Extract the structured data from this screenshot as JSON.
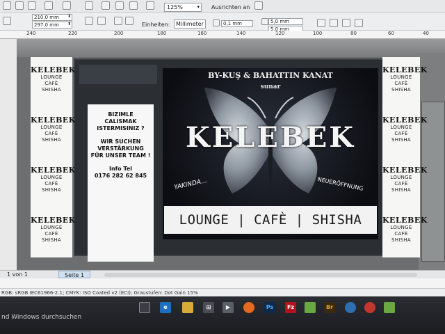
{
  "toolbar": {
    "zoom": "125%",
    "align_label": "Ausrichten an"
  },
  "properties": {
    "width": "210,0 mm",
    "height": "297,0 mm",
    "units_label": "Einheiten:",
    "units_value": "Millimeter",
    "nudge": "0,1 mm",
    "dup_x": "5,0 mm",
    "dup_y": "5,0 mm"
  },
  "ruler": {
    "ticks": [
      "240",
      "220",
      "200",
      "180",
      "160",
      "140",
      "120",
      "100",
      "80",
      "60",
      "40"
    ]
  },
  "sign": {
    "byline": "BY-KUŞ & BAHATTIN KANAT",
    "presents": "sunar",
    "brand": "KELEBEK",
    "tagline_left": "YAKINDA...",
    "tagline_right": "NEUERÖFFNUNG",
    "banner": "LOUNGE | CAFÈ | SHISHA",
    "side_brand": "KELEBEK",
    "side_lines": [
      "LOUNGE",
      "CAFÈ",
      "SHISHA"
    ],
    "job_lines_tr": [
      "BIZIMLE",
      "CALISMAK",
      "ISTERMISINIZ ?"
    ],
    "job_lines_de": [
      "WIR SUCHEN",
      "VERSTÄRKUNG",
      "FÜR UNSER TEAM !"
    ],
    "info_label": "Info Tel",
    "phone": "0176 282 62 845"
  },
  "pagebar": {
    "pager": "1 von 1",
    "page_tab": "Seite 1"
  },
  "status": {
    "color_profiles": "RGB: sRGB IEC61966-2.1; CMYK: ISO Coated v2 (ECI); Graustufen: Dot Gain 15%"
  },
  "taskbar": {
    "search": "nd Windows durchsuchen",
    "ps_label": "Ps",
    "fz_label": "Fz",
    "br_label": "Br"
  }
}
